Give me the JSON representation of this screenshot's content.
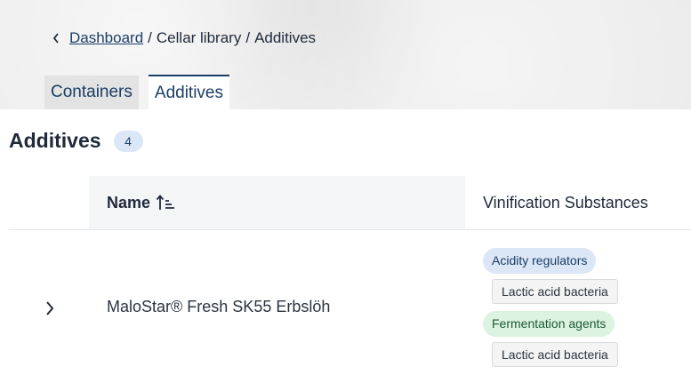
{
  "breadcrumb": {
    "back_icon": "chevron-left-icon",
    "dashboard": "Dashboard",
    "sep1": "/",
    "cellar": "Cellar library",
    "sep2": "/",
    "current": "Additives"
  },
  "tabs": [
    {
      "label": "Containers",
      "active": false
    },
    {
      "label": "Additives",
      "active": true
    }
  ],
  "title": "Additives",
  "count": "4",
  "table": {
    "columns": {
      "name": "Name",
      "name_sort_icon": "sort-ascending-icon",
      "substances": "Vinification Substances"
    },
    "rows": [
      {
        "expand_icon": "chevron-right-icon",
        "name": "MaloStar® Fresh SK55 Erbslöh",
        "groups": [
          {
            "category": "Acidity regulators",
            "color": "#dbe6f6",
            "item": "Lactic acid bacteria"
          },
          {
            "category": "Fermentation agents",
            "color": "#dcf3e2",
            "item": "Lactic acid bacteria"
          }
        ]
      }
    ]
  }
}
